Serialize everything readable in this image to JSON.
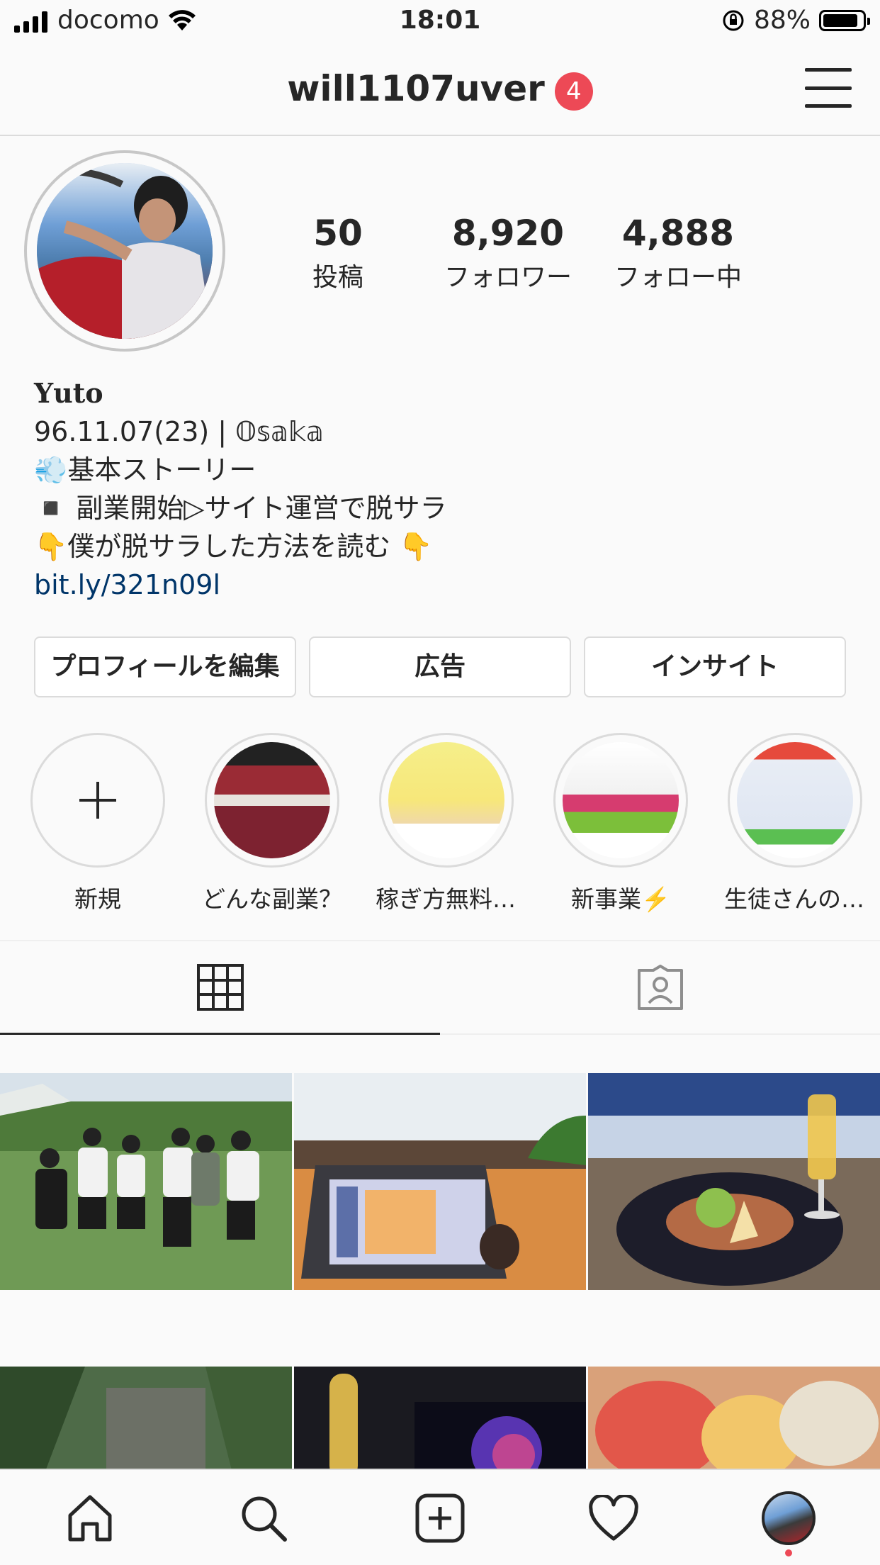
{
  "status_bar": {
    "carrier": "docomo",
    "time": "18:01",
    "battery_percent": "88%",
    "battery_level": 0.88
  },
  "header": {
    "username": "will1107uver",
    "notification_count": "4"
  },
  "profile": {
    "stats": [
      {
        "value": "50",
        "label": "投稿"
      },
      {
        "value": "8,920",
        "label": "フォロワー"
      },
      {
        "value": "4,888",
        "label": "フォロー中"
      }
    ],
    "bio": {
      "name": "𝐘𝐮𝐭𝐨",
      "line1": "96.11.07(23) | 𝕆𝕤𝕒𝕜𝕒",
      "line2": "💨基本ストーリー",
      "line3": "◾️ 副業開始▷サイト運営で脱サラ",
      "line4": "👇僕が脱サラした方法を読む 👇",
      "link": "bit.ly/321n09l"
    }
  },
  "actions": {
    "edit_profile": "プロフィールを編集",
    "promotions": "広告",
    "insights": "インサイト"
  },
  "highlights": [
    {
      "label": "新規"
    },
    {
      "label": "どんな副業？"
    },
    {
      "label": "稼ぎ方無料プ…"
    },
    {
      "label": "新事業⚡️"
    },
    {
      "label": "生徒さんの実績"
    }
  ],
  "tabs": [
    {
      "name": "grid",
      "icon": "grid-icon"
    },
    {
      "name": "tagged",
      "icon": "tagged-icon"
    }
  ],
  "nav": [
    {
      "icon": "home-icon"
    },
    {
      "icon": "search-icon"
    },
    {
      "icon": "add-post-icon"
    },
    {
      "icon": "heart-icon"
    },
    {
      "icon": "profile-avatar-icon"
    }
  ],
  "colors": {
    "badge": "#ed4956",
    "link": "#003569",
    "text": "#262626",
    "border": "#dbdbdb"
  }
}
